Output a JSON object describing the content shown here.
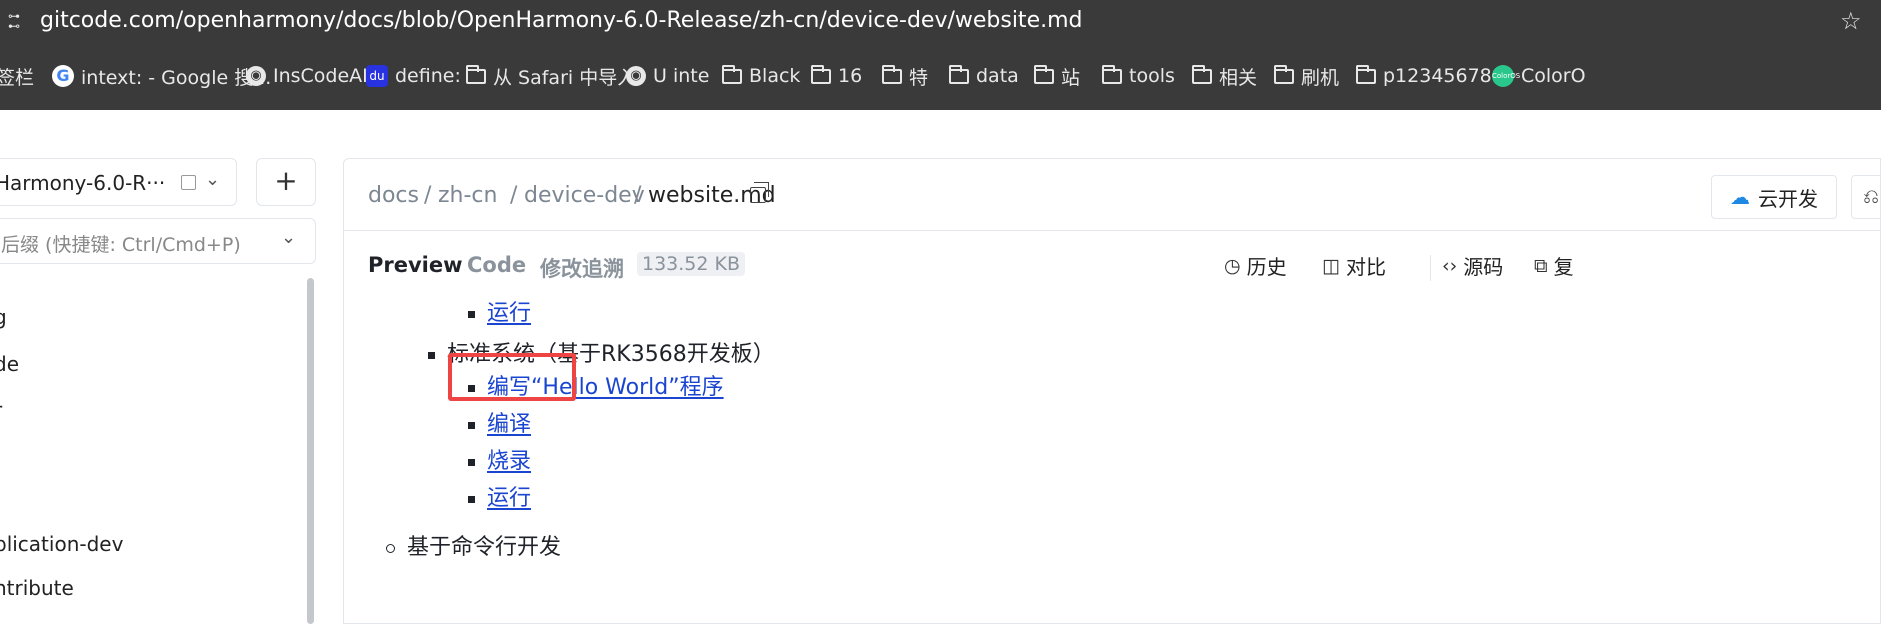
{
  "browser": {
    "url": "gitcode.com/openharmony/docs/blob/OpenHarmony-6.0-Release/zh-cn/device-dev/website.md",
    "bookmarks": [
      {
        "label": "签栏",
        "icon": "none-icon"
      },
      {
        "label": "intext: - Google 搜...",
        "icon": "google-icon"
      },
      {
        "label": "InsCodeAI",
        "icon": "globe-icon"
      },
      {
        "label": "define:",
        "icon": "baidu-icon"
      },
      {
        "label": "从 Safari 中导入",
        "icon": "folder-icon"
      },
      {
        "label": "U inte",
        "icon": "globe-icon"
      },
      {
        "label": "Black",
        "icon": "folder-icon"
      },
      {
        "label": "16",
        "icon": "folder-icon"
      },
      {
        "label": "特",
        "icon": "folder-icon"
      },
      {
        "label": "data",
        "icon": "folder-icon"
      },
      {
        "label": "站",
        "icon": "folder-icon"
      },
      {
        "label": "tools",
        "icon": "folder-icon"
      },
      {
        "label": "相关",
        "icon": "folder-icon"
      },
      {
        "label": "刷机",
        "icon": "folder-icon"
      },
      {
        "label": "p123456789",
        "icon": "folder-icon"
      },
      {
        "label": "ColorO",
        "icon": "coloros-icon"
      }
    ],
    "coloros_badge": "ColorOS"
  },
  "sidebar": {
    "branch": "Harmony-6.0-R···",
    "add_label": "+",
    "file_search_placeholder": "后缀 (快捷键: Ctrl/Cmd+P)",
    "tree_items": [
      "g",
      "de",
      "r",
      "plication-dev",
      "ntribute"
    ]
  },
  "main": {
    "breadcrumb": {
      "segments": [
        "docs",
        "zh-cn",
        "device-dev"
      ],
      "separator": "/",
      "current": "website.md"
    },
    "cloud_dev_label": "云开发",
    "tabs": {
      "preview": "Preview",
      "code": "Code",
      "blame": "修改追溯"
    },
    "file_size": "133.52 KB",
    "actions": {
      "history": "历史",
      "compare": "对比",
      "source": "源码",
      "copy": "复"
    },
    "content": {
      "item_run_1": "运行",
      "section_standard": "标准系统（基于RK3568开发板）",
      "item_hello": "编写“Hello World”程序",
      "item_compile": "编译",
      "item_burn": "烧录",
      "item_run_2": "运行",
      "section_cli": "基于命令行开发"
    }
  },
  "colors": {
    "link": "#1a45d0",
    "highlight": "#ee4444",
    "chrome": "#3a3a3a"
  }
}
